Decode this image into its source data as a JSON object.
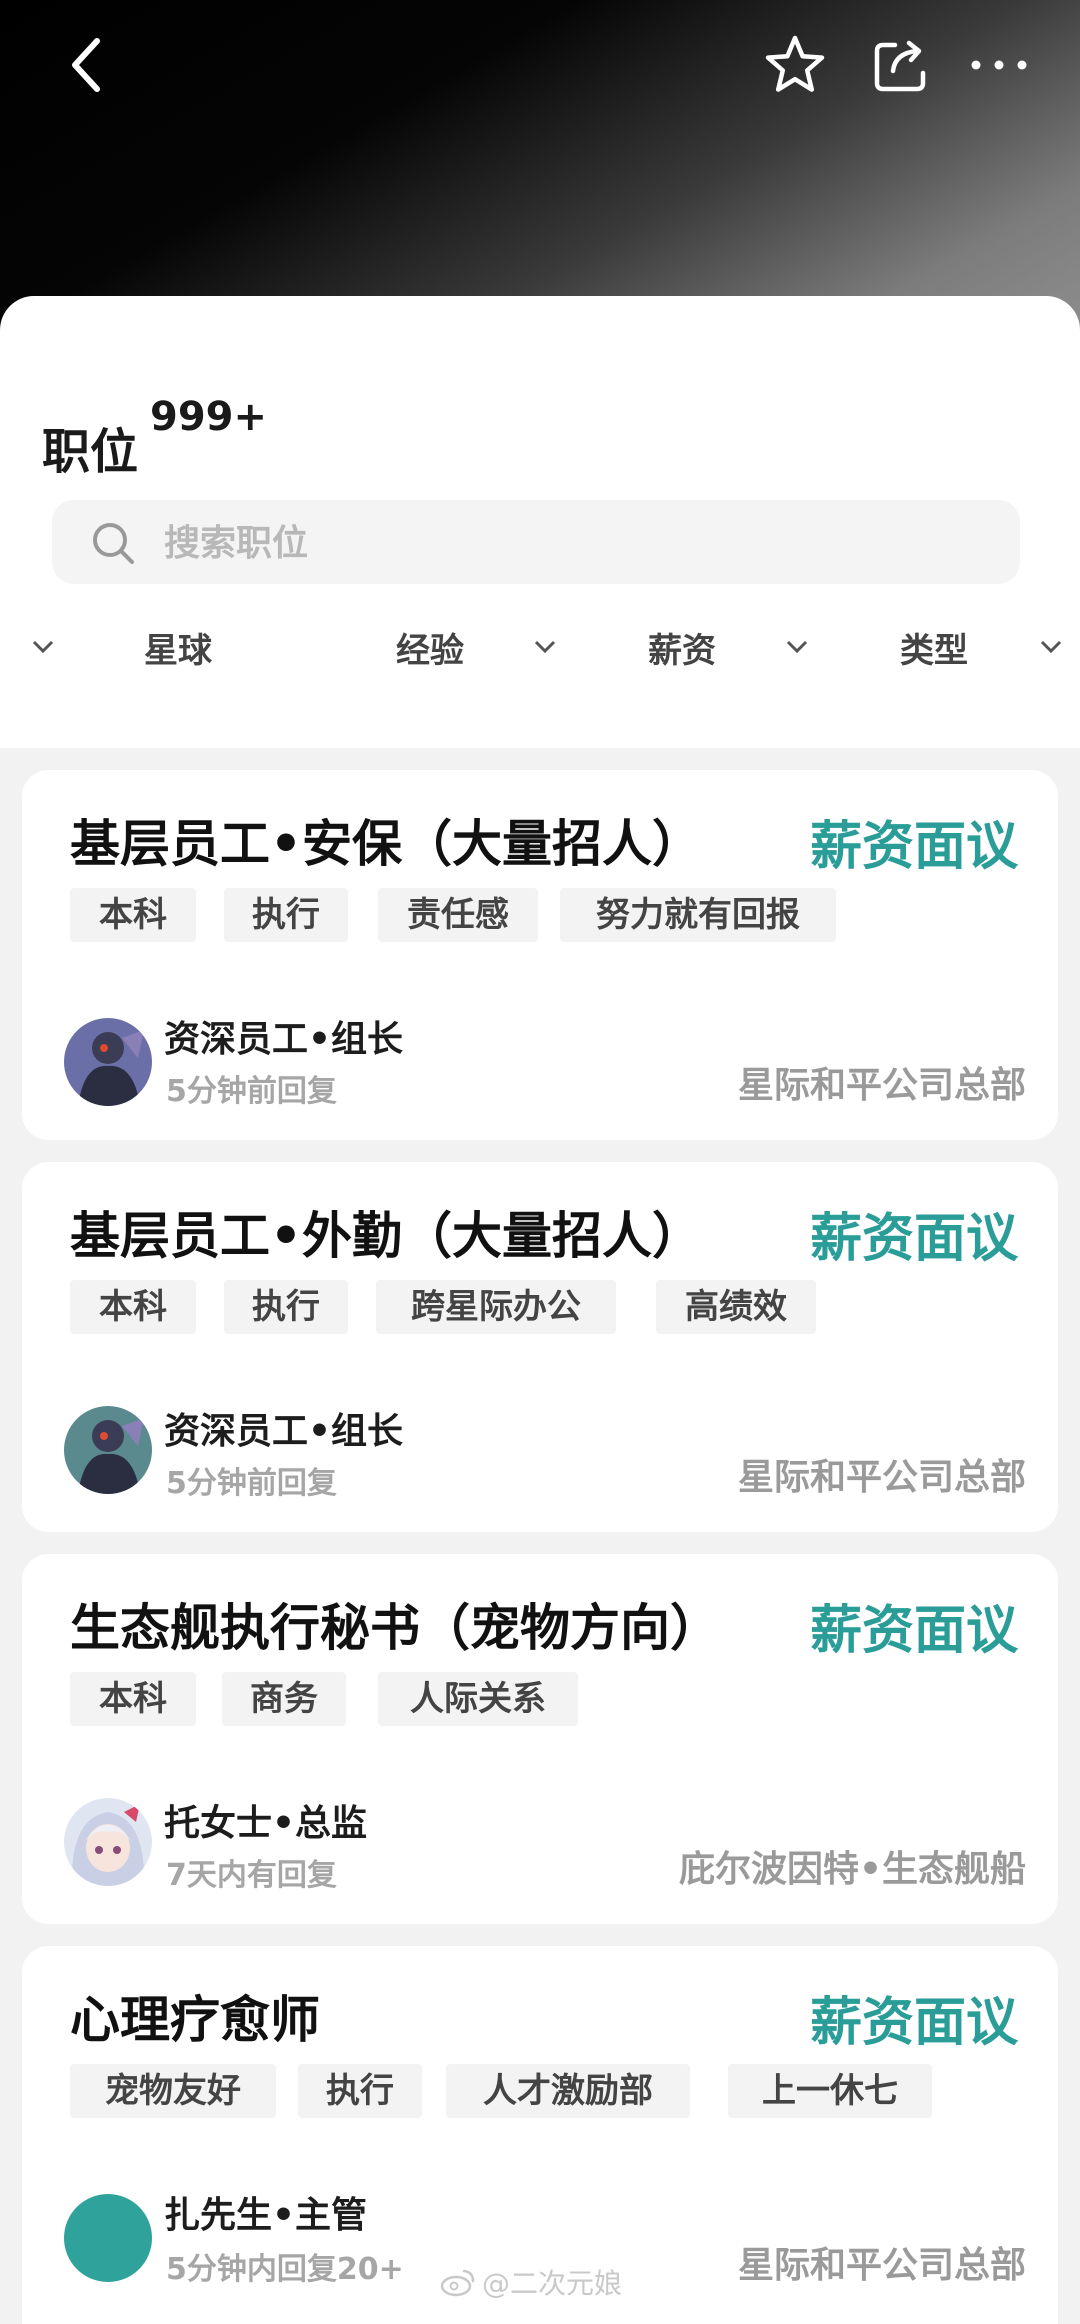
{
  "header": {
    "icons": [
      "back-arrow-icon",
      "star-icon",
      "share-icon",
      "more-icon"
    ]
  },
  "section": {
    "title": "职位",
    "count": "999+"
  },
  "search": {
    "placeholder": "搜索职位"
  },
  "filters": [
    "星球",
    "经验",
    "薪资",
    "类型"
  ],
  "colors": {
    "accent": "#2a9d99",
    "tag_bg": "#f3f3f3",
    "page_bg": "#f2f2f2"
  },
  "jobs": [
    {
      "title": "基层员工•安保（大量招人）",
      "salary": "薪资面议",
      "tags": [
        "本科",
        "执行",
        "责任感",
        "努力就有回报"
      ],
      "recruiter": "资深员工•组长",
      "reply": "5分钟前回复",
      "company": "星际和平公司总部"
    },
    {
      "title": "基层员工•外勤（大量招人）",
      "salary": "薪资面议",
      "tags": [
        "本科",
        "执行",
        "跨星际办公",
        "高绩效"
      ],
      "recruiter": "资深员工•组长",
      "reply": "5分钟前回复",
      "company": "星际和平公司总部"
    },
    {
      "title": "生态舰执行秘书（宠物方向）",
      "salary": "薪资面议",
      "tags": [
        "本科",
        "商务",
        "人际关系"
      ],
      "recruiter": "托女士•总监",
      "reply": "7天内有回复",
      "company": "庇尔波因特•生态舰船"
    },
    {
      "title": "心理疗愈师",
      "salary": "薪资面议",
      "tags": [
        "宠物友好",
        "执行",
        "人才激励部",
        "上一休七"
      ],
      "recruiter": "扎先生•主管",
      "reply": "5分钟内回复20+",
      "company": "星际和平公司总部"
    }
  ],
  "watermark": "@二次元娘"
}
